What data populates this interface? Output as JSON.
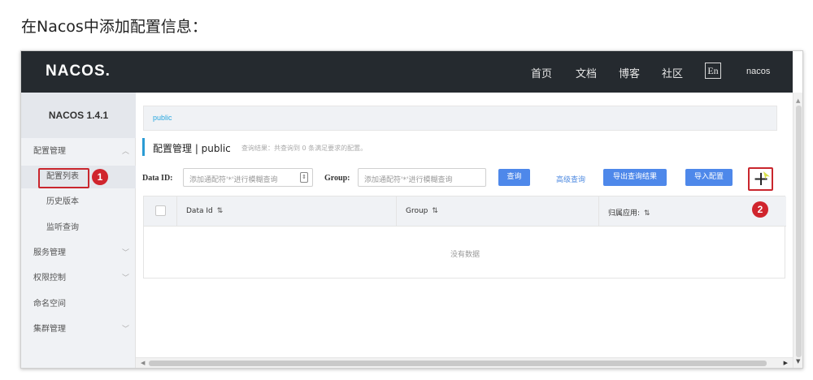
{
  "document": {
    "heading": "在Nacos中添加配置信息："
  },
  "topbar": {
    "logo": "NACOS.",
    "nav": [
      "首页",
      "文档",
      "博客",
      "社区"
    ],
    "language": "En",
    "user": "nacos"
  },
  "sidebar": {
    "version": "NACOS 1.4.1",
    "items": [
      {
        "label": "配置管理",
        "expanded": true
      },
      {
        "label": "配置列表",
        "active": true
      },
      {
        "label": "历史版本"
      },
      {
        "label": "监听查询"
      },
      {
        "label": "服务管理"
      },
      {
        "label": "权限控制"
      },
      {
        "label": "命名空间"
      },
      {
        "label": "集群管理"
      }
    ]
  },
  "main": {
    "namespace": "public",
    "page_title": "配置管理 | public",
    "result_summary": "查询结果：共查询到 0 条满足要求的配置。",
    "filters": {
      "data_id_label": "Data ID:",
      "data_id_placeholder": "添加通配符'*'进行模糊查询",
      "group_label": "Group:",
      "group_placeholder": "添加通配符'*'进行模糊查询"
    },
    "buttons": {
      "query": "查询",
      "advanced_query": "高级查询",
      "export": "导出查询结果",
      "import": "导入配置",
      "add": "+"
    },
    "table": {
      "columns": [
        "Data Id",
        "Group",
        "归属应用:"
      ],
      "sort_icon": "⇅",
      "empty_text": "没有数据"
    }
  },
  "annotations": {
    "step1": "1",
    "step2": "2"
  },
  "colors": {
    "topbar": "#252a2f",
    "primary_button": "#4e88ea",
    "highlight_red": "#c9262d",
    "namespace_link": "#2aa8e0"
  }
}
